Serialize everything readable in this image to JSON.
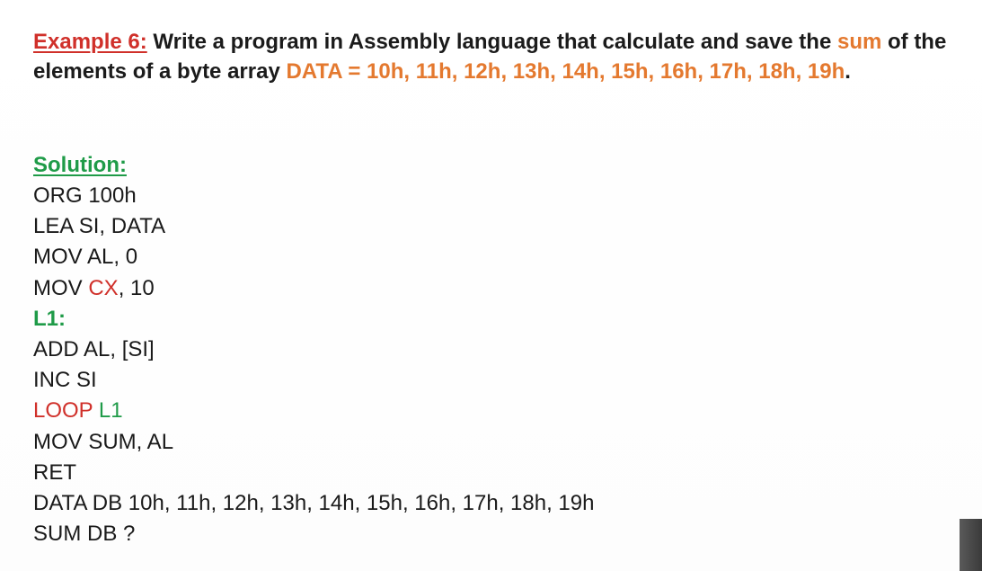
{
  "problem": {
    "example_label": "Example 6:",
    "text_1": " Write a program in Assembly language that calculate and save the ",
    "sum_word": "sum",
    "text_2": " of the elements of a byte array ",
    "array_values": "DATA = 10h, 11h, 12h, 13h, 14h, 15h, 16h, 17h, 18h, 19h",
    "period": "."
  },
  "solution": {
    "label": "Solution:",
    "lines": {
      "org": "ORG 100h",
      "lea": "LEA SI, DATA",
      "mov_al": "MOV AL, 0",
      "mov_cx_prefix": "MOV ",
      "mov_cx_reg": "CX",
      "mov_cx_suffix": ", 10",
      "label_l1": "L1:",
      "add": "ADD AL, [SI]",
      "inc": "INC SI",
      "loop_keyword": "LOOP",
      "loop_target": " L1",
      "mov_sum": "MOV SUM, AL",
      "ret": "RET",
      "data_db": "DATA DB 10h, 11h, 12h, 13h, 14h, 15h, 16h, 17h, 18h, 19h",
      "sum_db": "SUM DB ?"
    }
  },
  "colors": {
    "example_label": "#d0302a",
    "highlight_orange": "#e4792f",
    "solution_green": "#1f9b48",
    "register_red": "#d0302a"
  }
}
